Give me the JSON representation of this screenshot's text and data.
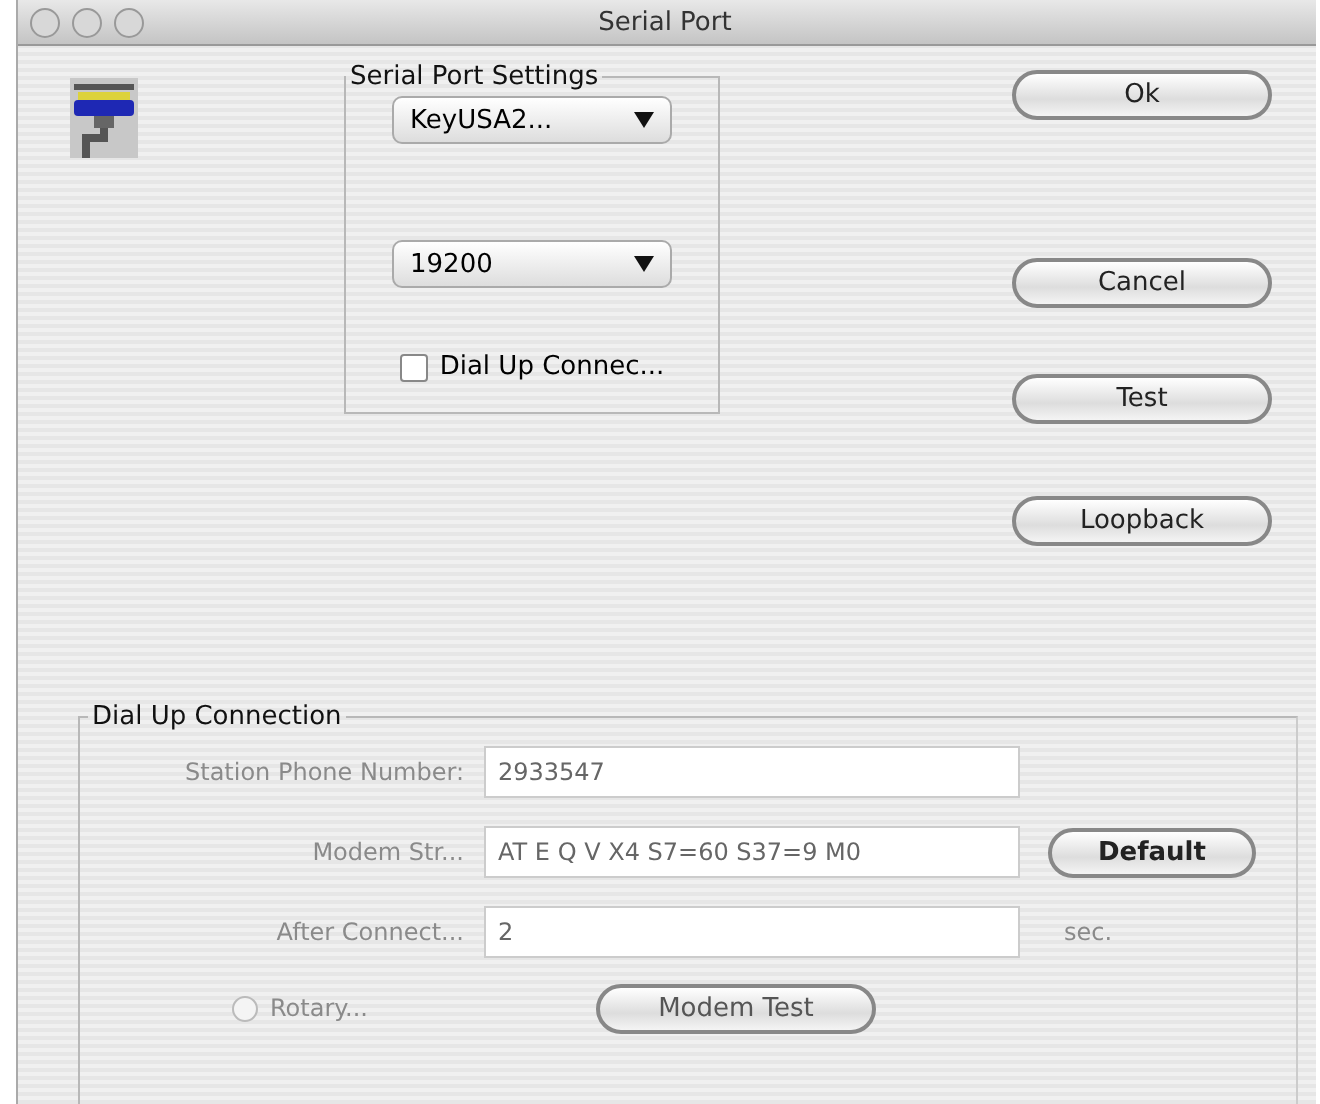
{
  "window": {
    "title": "Serial Port"
  },
  "serial_port_settings": {
    "title": "Serial Port Settings",
    "port_popup": "KeyUSA2...",
    "speed_popup": "19200",
    "dial_up_checkbox": {
      "label": "Dial Up Connec...",
      "checked": false
    }
  },
  "buttons": [
    "Ok",
    "Cancel",
    "Test",
    "Loopback"
  ],
  "dial_up_connection": {
    "title": "Dial Up Connection",
    "disabled": true,
    "fields": [
      {
        "label": "Station Phone Number:",
        "value": "2933547"
      },
      {
        "label": "Modem Str...",
        "value": "AT E Q V X4 S7=60 S37=9 M0",
        "button": "Default"
      },
      {
        "label": "After Connect...",
        "value": "2",
        "unit": "sec."
      }
    ],
    "rotary": {
      "label": "Rotary...",
      "selected": false
    },
    "modem_test_button": "Modem Test"
  }
}
